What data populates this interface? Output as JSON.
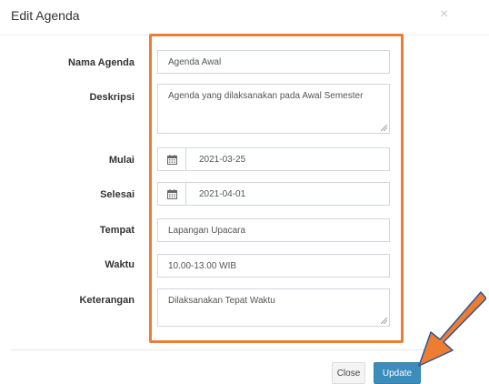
{
  "modal": {
    "title": "Edit Agenda",
    "close_icon": "×"
  },
  "form": {
    "nama_agenda": {
      "label": "Nama Agenda",
      "value": "Agenda Awal"
    },
    "deskripsi": {
      "label": "Deskripsi",
      "value": "Agenda yang dilaksanakan pada Awal Semester"
    },
    "mulai": {
      "label": "Mulai",
      "value": "2021-03-25",
      "icon": "calendar-icon"
    },
    "selesai": {
      "label": "Selesai",
      "value": "2021-04-01",
      "icon": "calendar-icon"
    },
    "tempat": {
      "label": "Tempat",
      "value": "Lapangan Upacara"
    },
    "waktu": {
      "label": "Waktu",
      "value": "10.00-13.00 WIB"
    },
    "keterangan": {
      "label": "Keterangan",
      "value": "Dilaksanakan Tepat Waktu"
    }
  },
  "footer": {
    "close_label": "Close",
    "update_label": "Update"
  },
  "colors": {
    "highlight": "#ed7d31",
    "primary": "#3c8dbc"
  }
}
